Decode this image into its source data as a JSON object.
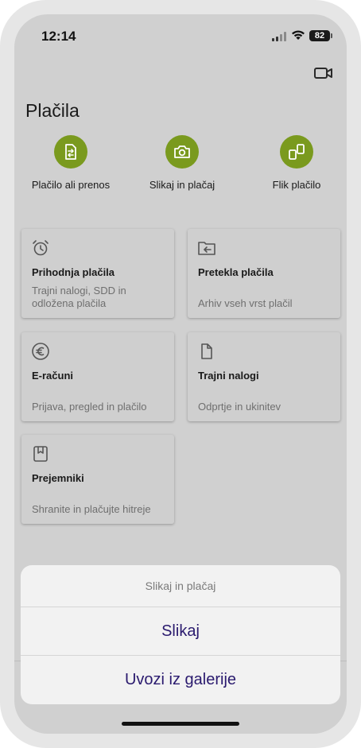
{
  "status_bar": {
    "time": "12:14",
    "battery": "82"
  },
  "page": {
    "title": "Plačila"
  },
  "quick_actions": [
    {
      "label": "Plačilo ali prenos",
      "icon": "payment-transfer-icon"
    },
    {
      "label": "Slikaj in plačaj",
      "icon": "camera-icon"
    },
    {
      "label": "Flik plačilo",
      "icon": "flik-icon"
    }
  ],
  "cards": [
    {
      "title": "Prihodnja plačila",
      "subtitle": "Trajni nalogi, SDD in odložena plačila",
      "icon": "alarm-clock-icon"
    },
    {
      "title": "Pretekla plačila",
      "subtitle": "Arhiv vseh vrst plačil",
      "icon": "folder-arrow-icon"
    },
    {
      "title": "E-računi",
      "subtitle": "Prijava, pregled in plačilo",
      "icon": "euro-icon"
    },
    {
      "title": "Trajni nalogi",
      "subtitle": "Odprtje in ukinitev",
      "icon": "document-icon"
    },
    {
      "title": "Prejemniki",
      "subtitle": "Shranite in plačujte hitreje",
      "icon": "address-book-icon"
    }
  ],
  "action_sheet": {
    "title": "Slikaj in plačaj",
    "options": [
      "Slikaj",
      "Uvozi iz galerije"
    ]
  },
  "colors": {
    "accent": "#7a9a1e",
    "sheet_text": "#2a1a6e",
    "dim_background": "#d0d0d0"
  }
}
